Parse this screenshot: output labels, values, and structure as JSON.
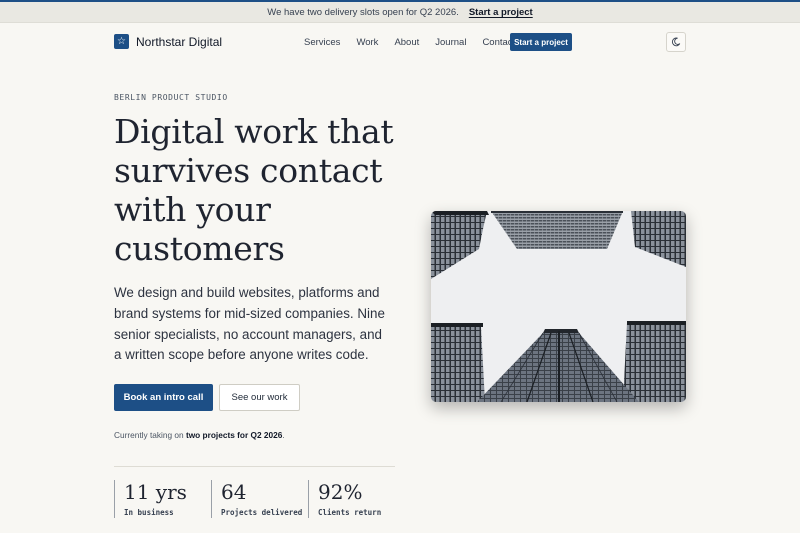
{
  "announcement": {
    "text": "We have two delivery slots open for Q2 2026.",
    "link": "Start a project"
  },
  "nav": {
    "brand": "Northstar Digital",
    "brand_icon": "star-icon",
    "links": [
      "Services",
      "Work",
      "About",
      "Journal",
      "Contact"
    ],
    "cta": "Start a project",
    "theme_icon": "moon-icon"
  },
  "hero": {
    "eyebrow": "BERLIN PRODUCT STUDIO",
    "headline": "Digital work that survives contact with your customers",
    "lede": "We design and build websites, platforms and brand systems for mid-sized companies. Nine senior specialists, no account managers, and a written scope before anyone writes code.",
    "primary_button": "Book an intro call",
    "secondary_button": "See our work",
    "availability_prefix": "Currently taking on ",
    "availability_bold": "two projects for Q2 2026",
    "availability_suffix": ".",
    "image_subject": "skyscrapers viewed from below"
  },
  "stats": [
    {
      "value": "11 yrs",
      "label": "In business"
    },
    {
      "value": "64",
      "label": "Projects delivered"
    },
    {
      "value": "92%",
      "label": "Clients return"
    }
  ],
  "colors": {
    "accent": "#1d4f86",
    "background": "#f8f7f3",
    "announcement_bg": "#e9e8e2"
  }
}
